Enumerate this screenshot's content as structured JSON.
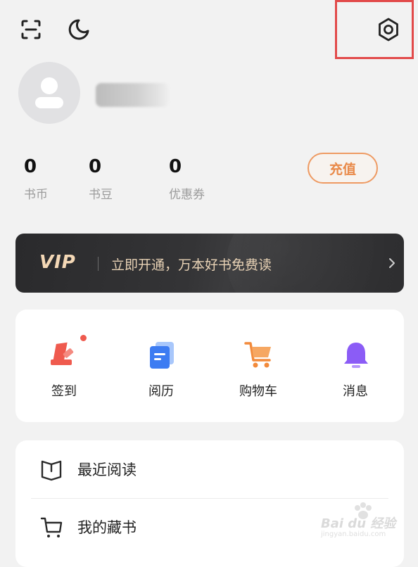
{
  "top_bar": {
    "scan_icon": "scan-icon",
    "night_mode_icon": "moon-icon",
    "settings_icon": "gear-icon",
    "highlight_color": "#e24a4a"
  },
  "profile": {
    "avatar_icon": "user-avatar-icon"
  },
  "stats": [
    {
      "value": "0",
      "label": "书币"
    },
    {
      "value": "0",
      "label": "书豆"
    },
    {
      "value": "0",
      "label": "优惠券"
    }
  ],
  "recharge_label": "充值",
  "vip": {
    "badge": "VIP",
    "text": "立即开通，万本好书免费读",
    "accent": "#f4d8b6"
  },
  "shortcuts": [
    {
      "label": "签到",
      "icon": "checkin-icon",
      "color": "#ef5a4e",
      "has_dot": true
    },
    {
      "label": "阅历",
      "icon": "history-icon",
      "color": "#3d7cf2",
      "has_dot": false
    },
    {
      "label": "购物车",
      "icon": "cart-icon",
      "color": "#f28a3b",
      "has_dot": false
    },
    {
      "label": "消息",
      "icon": "bell-icon",
      "color": "#8b5cf6",
      "has_dot": false
    }
  ],
  "menu": [
    {
      "label": "最近阅读",
      "icon": "open-book-icon"
    },
    {
      "label": "我的藏书",
      "icon": "shopping-cart-outline-icon"
    }
  ],
  "watermark": {
    "text": "Bai du 经验",
    "sub": "jingyan.baidu.com"
  }
}
